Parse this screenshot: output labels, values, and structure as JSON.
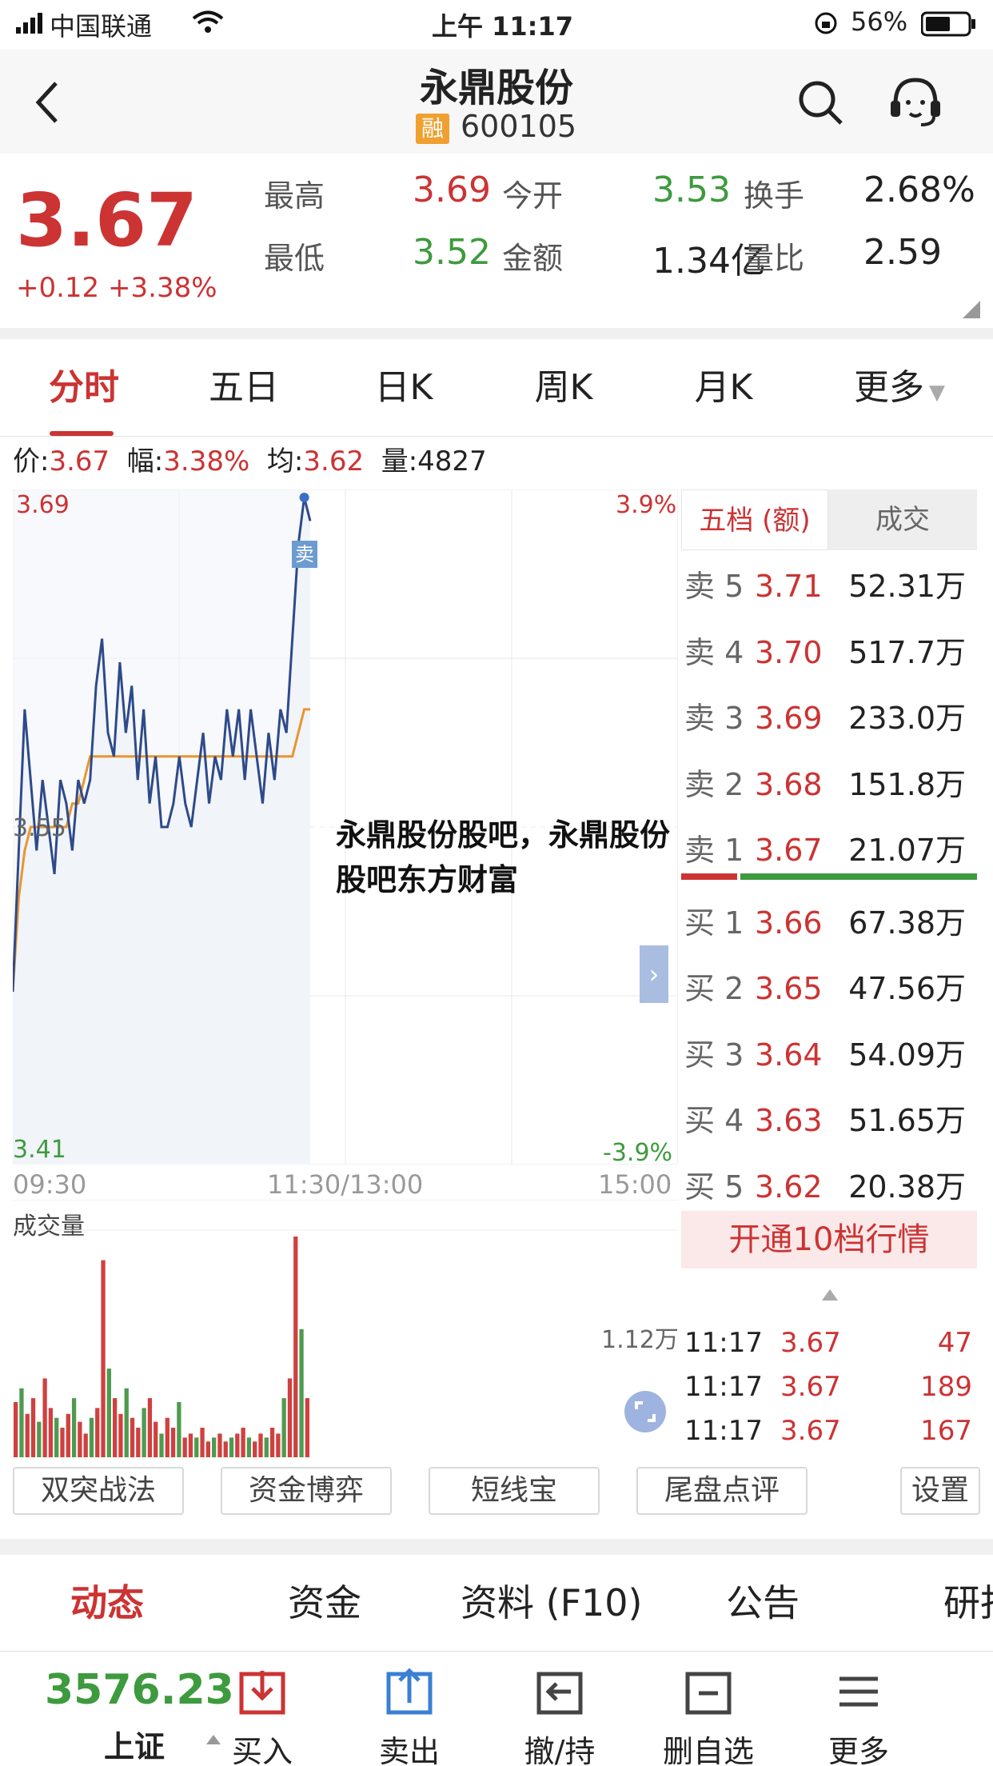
{
  "status": {
    "carrier": "中国联通",
    "time": "上午 11:17",
    "battery": "56%"
  },
  "nav": {
    "title": "永鼎股份",
    "badge": "融",
    "code": "600105"
  },
  "quote": {
    "price": "3.67",
    "change": "+0.12",
    "change_pct": "+3.38%",
    "fields": [
      {
        "label": "最高",
        "value": "3.69",
        "color": "#cc3333"
      },
      {
        "label": "今开",
        "value": "3.53",
        "color": "#3e9a3e"
      },
      {
        "label": "换手",
        "value": "2.68%",
        "color": "#222222"
      },
      {
        "label": "最低",
        "value": "3.52",
        "color": "#3e9a3e"
      },
      {
        "label": "金额",
        "value": "1.34亿",
        "color": "#222222"
      },
      {
        "label": "量比",
        "value": "2.59",
        "color": "#222222"
      }
    ]
  },
  "tabs": [
    "分时",
    "五日",
    "日K",
    "周K",
    "月K",
    "更多"
  ],
  "active_tab": "分时",
  "infoline": {
    "price_label": "价:",
    "price": "3.67",
    "amp_label": "幅:",
    "amp": "3.38%",
    "avg_label": "均:",
    "avg": "3.62",
    "vol_label": "量:",
    "vol": "4827"
  },
  "chart": {
    "y_top": "3.69",
    "y_mid": "3.55",
    "y_bottom": "3.41",
    "pct_top": "3.9%",
    "pct_bottom": "-3.9%",
    "x_start": "09:30",
    "x_mid": "11:30/13:00",
    "x_end": "15:00",
    "sell_marker": "卖",
    "volume_title": "成交量",
    "volume_max": "1.12万"
  },
  "chart_data": {
    "type": "line",
    "ylim": [
      3.41,
      3.69
    ],
    "series": [
      {
        "values": [
          3.48,
          3.54,
          3.6,
          3.57,
          3.54,
          3.57,
          3.55,
          3.53,
          3.57,
          3.56,
          3.54,
          3.57,
          3.56,
          3.57,
          3.61,
          3.63,
          3.59,
          3.58,
          3.62,
          3.59,
          3.61,
          3.57,
          3.6,
          3.56,
          3.58,
          3.55,
          3.55,
          3.56,
          3.58,
          3.56,
          3.55,
          3.57,
          3.59,
          3.56,
          3.58,
          3.57,
          3.6,
          3.58,
          3.6,
          3.57,
          3.6,
          3.58,
          3.56,
          3.59,
          3.57,
          3.6,
          3.59,
          3.63,
          3.67,
          3.69,
          3.68
        ]
      },
      {
        "values": [
          3.48,
          3.52,
          3.54,
          3.55,
          3.55,
          3.55,
          3.55,
          3.55,
          3.55,
          3.55,
          3.56,
          3.56,
          3.57,
          3.58,
          3.58,
          3.58,
          3.58,
          3.58,
          3.58,
          3.58,
          3.58,
          3.58,
          3.58,
          3.58,
          3.58,
          3.58,
          3.58,
          3.58,
          3.58,
          3.58,
          3.58,
          3.58,
          3.58,
          3.58,
          3.58,
          3.58,
          3.58,
          3.58,
          3.58,
          3.58,
          3.58,
          3.58,
          3.58,
          3.58,
          3.58,
          3.58,
          3.58,
          3.58,
          3.59,
          3.6,
          3.6
        ]
      }
    ],
    "volume": [
      0.28,
      0.35,
      0.22,
      0.3,
      0.18,
      0.4,
      0.25,
      0.2,
      0.15,
      0.22,
      0.3,
      0.18,
      0.12,
      0.2,
      0.25,
      1.0,
      0.45,
      0.3,
      0.22,
      0.35,
      0.2,
      0.15,
      0.25,
      0.3,
      0.18,
      0.12,
      0.2,
      0.15,
      0.28,
      0.1,
      0.12,
      0.1,
      0.15,
      0.08,
      0.1,
      0.12,
      0.08,
      0.1,
      0.12,
      0.15,
      0.1,
      0.08,
      0.12,
      0.1,
      0.15,
      0.12,
      0.3,
      0.4,
      1.12,
      0.65,
      0.3
    ]
  },
  "orderbook": {
    "tab_active": "五档 (额)",
    "tab_other": "成交",
    "asks": [
      {
        "label": "卖 5",
        "price": "3.71",
        "amount": "52.31万"
      },
      {
        "label": "卖 4",
        "price": "3.70",
        "amount": "517.7万"
      },
      {
        "label": "卖 3",
        "price": "3.69",
        "amount": "233.0万"
      },
      {
        "label": "卖 2",
        "price": "3.68",
        "amount": "151.8万"
      },
      {
        "label": "卖 1",
        "price": "3.67",
        "amount": "21.07万"
      }
    ],
    "bids": [
      {
        "label": "买 1",
        "price": "3.66",
        "amount": "67.38万"
      },
      {
        "label": "买 2",
        "price": "3.65",
        "amount": "47.56万"
      },
      {
        "label": "买 3",
        "price": "3.64",
        "amount": "54.09万"
      },
      {
        "label": "买 4",
        "price": "3.63",
        "amount": "51.65万"
      },
      {
        "label": "买 5",
        "price": "3.62",
        "amount": "20.38万"
      }
    ],
    "promo": "开通10档行情",
    "ticks": [
      {
        "time": "11:17",
        "price": "3.67",
        "vol": "47"
      },
      {
        "time": "11:17",
        "price": "3.67",
        "vol": "189"
      },
      {
        "time": "11:17",
        "price": "3.67",
        "vol": "167"
      }
    ]
  },
  "toolbar": [
    "双突战法",
    "资金博弈",
    "短线宝",
    "尾盘点评",
    "设置"
  ],
  "subtabs": [
    "动态",
    "资金",
    "资料 (F10)",
    "公告",
    "研报"
  ],
  "bottomnav": {
    "index_value": "3576.23",
    "index_name": "上证",
    "items": [
      {
        "label": "买入",
        "icon": "download-box-icon",
        "color": "#cc3333"
      },
      {
        "label": "卖出",
        "icon": "upload-box-icon",
        "color": "#3b7fd4"
      },
      {
        "label": "撤/持",
        "icon": "undo-box-icon",
        "color": "#444444"
      },
      {
        "label": "删自选",
        "icon": "minus-box-icon",
        "color": "#444444"
      },
      {
        "label": "更多",
        "icon": "menu-list-icon",
        "color": "#444444"
      }
    ]
  },
  "watermark": "永鼎股份股吧，永鼎股份股吧东方财富"
}
